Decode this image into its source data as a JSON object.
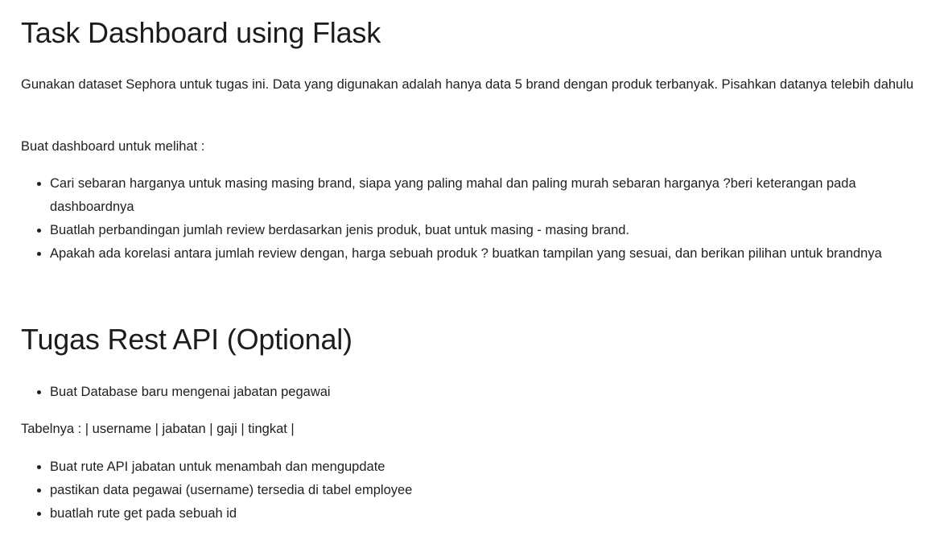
{
  "section1": {
    "title": "Task Dashboard using Flask",
    "intro": "Gunakan dataset Sephora untuk tugas ini. Data yang digunakan adalah hanya data 5 brand dengan produk terbanyak. Pisahkan datanya telebih dahulu",
    "lead": "Buat dashboard untuk melihat :",
    "items": [
      "Cari sebaran harganya untuk masing masing brand, siapa yang paling mahal dan paling murah sebaran harganya ?beri keterangan pada dashboardnya",
      "Buatlah perbandingan jumlah review berdasarkan jenis produk, buat untuk masing - masing brand.",
      "Apakah ada korelasi antara jumlah review dengan, harga sebuah produk ? buatkan tampilan yang sesuai, dan berikan pilihan untuk brandnya"
    ]
  },
  "section2": {
    "title": "Tugas Rest API (Optional)",
    "items_a": [
      "Buat Database baru mengenai jabatan pegawai"
    ],
    "table_line": "Tabelnya : | username | jabatan | gaji | tingkat |",
    "items_b": [
      "Buat rute API jabatan untuk menambah dan mengupdate",
      "pastikan data pegawai (username) tersedia di tabel employee",
      "buatlah rute get pada sebuah id"
    ]
  }
}
